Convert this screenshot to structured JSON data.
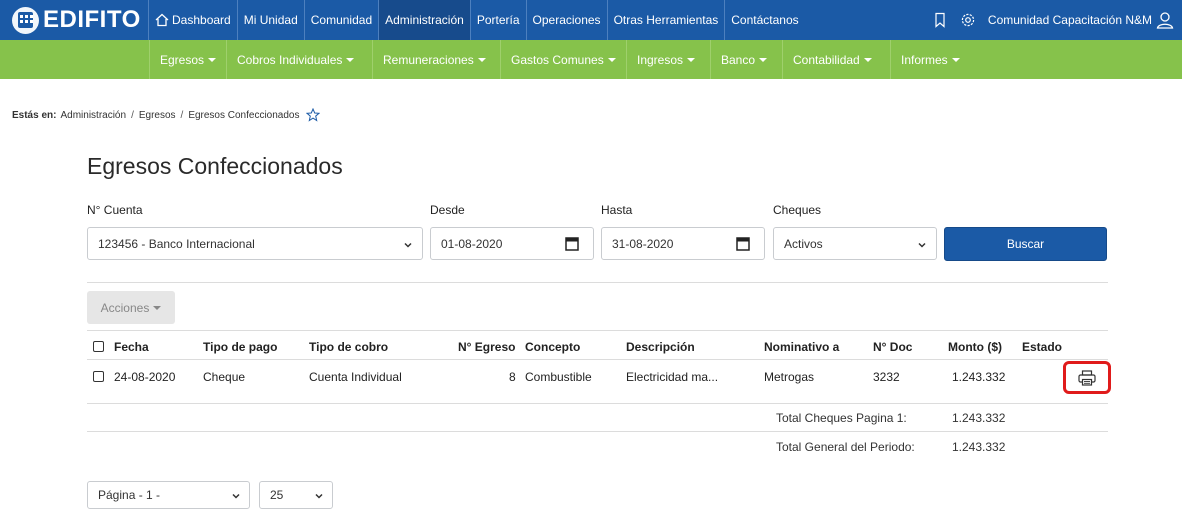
{
  "brand": {
    "name": "EDIFITO"
  },
  "topnav": {
    "items": [
      "Dashboard",
      "Mi Unidad",
      "Comunidad",
      "Administración",
      "Portería",
      "Operaciones",
      "Otras Herramientas",
      "Contáctanos"
    ],
    "active": "Administración",
    "user": "Comunidad Capacitación N&M"
  },
  "menu": {
    "items": [
      "Egresos",
      "Cobros Individuales",
      "Remuneraciones",
      "Gastos Comunes",
      "Ingresos",
      "Banco",
      "Contabilidad",
      "Informes"
    ]
  },
  "breadcrumb": {
    "label": "Estás en:",
    "path": [
      "Administración",
      "Egresos",
      "Egresos Confeccionados"
    ]
  },
  "page": {
    "title": "Egresos Confeccionados"
  },
  "filters": {
    "cuenta_label": "N° Cuenta",
    "cuenta_value": "123456 - Banco Internacional",
    "desde_label": "Desde",
    "desde_value": "01-08-2020",
    "hasta_label": "Hasta",
    "hasta_value": "31-08-2020",
    "cheques_label": "Cheques",
    "cheques_value": "Activos",
    "search_label": "Buscar"
  },
  "actions": {
    "label": "Acciones"
  },
  "table": {
    "headers": [
      "Fecha",
      "Tipo de pago",
      "Tipo de cobro",
      "N° Egreso",
      "Concepto",
      "Descripción",
      "Nominativo a",
      "N° Doc",
      "Monto ($)",
      "Estado"
    ],
    "rows": [
      [
        "24-08-2020",
        "Cheque",
        "Cuenta Individual",
        "8",
        "Combustible",
        "Electricidad ma...",
        "Metrogas",
        "3232",
        "1.243.332",
        ""
      ]
    ]
  },
  "totals": {
    "page_label": "Total Cheques Pagina 1:",
    "page_value": "1.243.332",
    "period_label": "Total General del Periodo:",
    "period_value": "1.243.332"
  },
  "pagination": {
    "page_value": "Página - 1 -",
    "size_value": "25"
  },
  "colors": {
    "primary": "#1b5aa6",
    "menu_green": "#86c24b",
    "highlight": "#e01b1b"
  }
}
